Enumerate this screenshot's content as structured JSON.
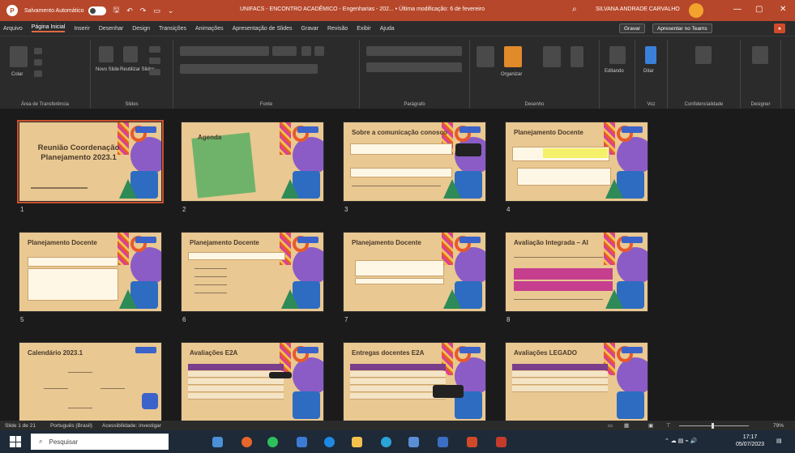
{
  "titlebar": {
    "autosave_label": "Salvamento Automático",
    "title": "UNIFACS - ENCONTRO ACADÊMICO - Engenharias - 202... • Última modificação: 6 de fevereiro",
    "user_name": "SILVANA ANDRADE CARVALHO"
  },
  "menubar": {
    "items": [
      "Arquivo",
      "Página Inicial",
      "Inserir",
      "Desenhar",
      "Design",
      "Transições",
      "Animações",
      "Apresentação de Slides",
      "Gravar",
      "Revisão",
      "Exibir",
      "Ajuda"
    ],
    "share_label": "Gravar",
    "present_label": "Apresentar no Teams"
  },
  "ribbon": {
    "groups": [
      "Área de Transferência",
      "Slides",
      "Fonte",
      "Parágrafo",
      "Desenho",
      "Voz",
      "Confidencialidade",
      "Designer"
    ],
    "paste_label": "Colar",
    "new_slide_label": "Novo Slide",
    "reuse_label": "Reutilizar Slides",
    "arrange_label": "Organizar",
    "editing_label": "Editando",
    "dictate_label": "Ditar"
  },
  "slides": [
    {
      "num": "1",
      "title": "Reunião Coordenação Planejamento 2023.1"
    },
    {
      "num": "2",
      "title": "Agenda"
    },
    {
      "num": "3",
      "title": "Sobre a comunicação conosco"
    },
    {
      "num": "4",
      "title": "Planejamento Docente"
    },
    {
      "num": "5",
      "title": "Planejamento Docente"
    },
    {
      "num": "6",
      "title": "Planejamento Docente"
    },
    {
      "num": "7",
      "title": "Planejamento Docente"
    },
    {
      "num": "8",
      "title": "Avaliação Integrada – AI"
    },
    {
      "num": "",
      "title": "Calendário 2023.1"
    },
    {
      "num": "",
      "title": "Avaliações E2A"
    },
    {
      "num": "",
      "title": "Entregas docentes E2A"
    },
    {
      "num": "",
      "title": "Avaliações LEGADO"
    }
  ],
  "statusbar": {
    "slide_count": "Slide 1 de 21",
    "language": "Português (Brasil)",
    "accessibility": "Acessibilidade: investigar",
    "zoom": "79%"
  },
  "taskbar": {
    "search_placeholder": "Pesquisar",
    "time": "17:17",
    "date": "05/07/2023"
  },
  "colors": {
    "accent": "#b7472a",
    "slide_bg": "#e9c892"
  }
}
